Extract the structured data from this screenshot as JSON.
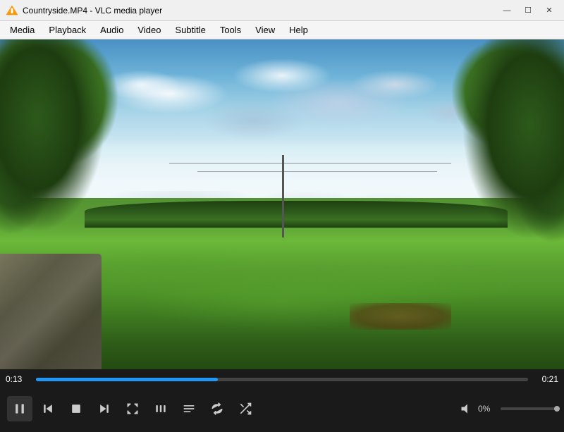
{
  "window": {
    "title": "Countryside.MP4 - VLC media player",
    "logo": "🔶"
  },
  "window_controls": {
    "minimize": "—",
    "maximize": "☐",
    "close": "✕"
  },
  "menu": {
    "items": [
      "Media",
      "Playback",
      "Audio",
      "Video",
      "Subtitle",
      "Tools",
      "View",
      "Help"
    ]
  },
  "progress": {
    "current": "0:13",
    "total": "0:21",
    "fill_percent": "37%"
  },
  "volume": {
    "label": "0%",
    "fill_percent": "0%"
  },
  "controls": {
    "pause_label": "⏸",
    "prev_label": "⏮",
    "stop_label": "⏹",
    "next_label": "⏭",
    "fullscreen_label": "⛶",
    "extended_label": "|||",
    "playlist_label": "≡",
    "loop_label": "↺",
    "random_label": "⤮"
  }
}
